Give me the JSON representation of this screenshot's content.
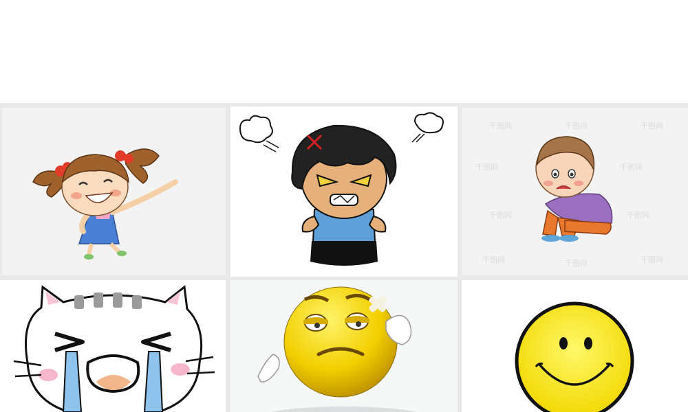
{
  "grid": {
    "tiles": [
      {
        "id": "t1",
        "subject": "happy-girl-pigtails"
      },
      {
        "id": "t2",
        "subject": "angry-boy"
      },
      {
        "id": "t3",
        "subject": "sad-boy-sitting"
      },
      {
        "id": "t4",
        "subject": "crying-cat"
      },
      {
        "id": "t5",
        "subject": "bored-yellow-emoji"
      },
      {
        "id": "t6",
        "subject": "smiley-face"
      }
    ]
  },
  "colors": {
    "gap": "#e9e9e9",
    "tile_bg": "#f3f3f3",
    "smiley_yellow": "#f7e200",
    "hair_brown": "#a0622d",
    "angry_shirt": "#5e9fd8"
  }
}
